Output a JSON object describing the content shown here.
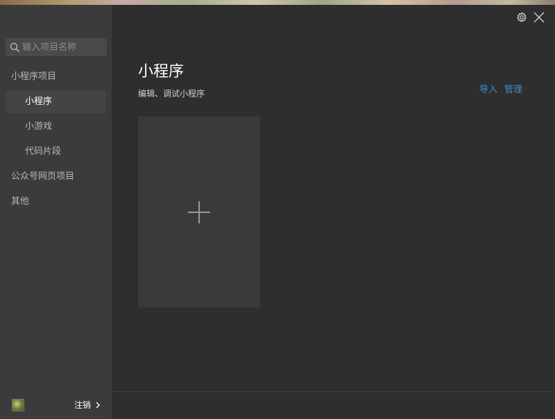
{
  "search": {
    "placeholder": "输入项目名称"
  },
  "sidebar": {
    "items": [
      {
        "label": "小程序项目"
      },
      {
        "label": "小程序"
      },
      {
        "label": "小游戏"
      },
      {
        "label": "代码片段"
      },
      {
        "label": "公众号网页项目"
      },
      {
        "label": "其他"
      }
    ],
    "footer": {
      "logout_label": "注销"
    }
  },
  "main": {
    "title": "小程序",
    "subtitle": "编辑、调试小程序",
    "actions": {
      "import_label": "导入",
      "manage_label": "管理"
    }
  },
  "icons": {
    "search": "search-icon",
    "settings": "gear-icon",
    "close": "close-icon",
    "add": "plus-icon",
    "chevron": "chevron-right-icon"
  },
  "colors": {
    "sidebar_bg": "#3b3b3b",
    "main_bg": "#2e2e2e",
    "card_bg": "#3a3a3a",
    "active_bg": "#444444",
    "link": "#3d8fd1"
  }
}
